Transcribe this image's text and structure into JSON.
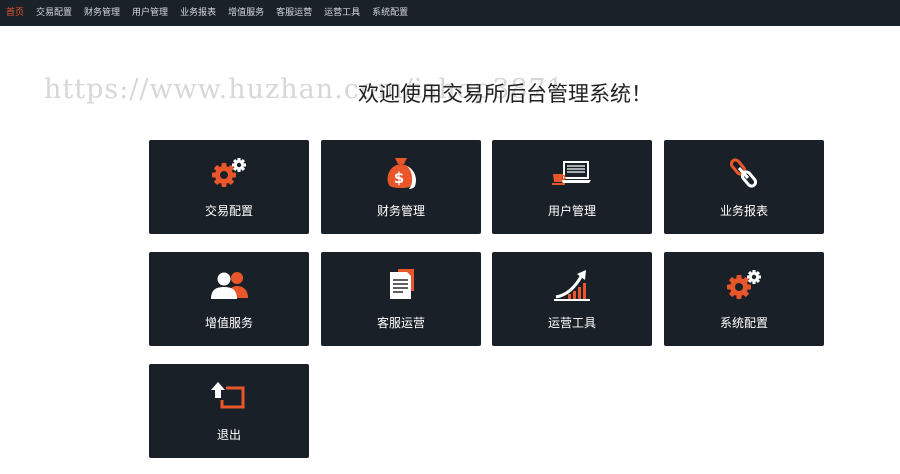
{
  "nav": {
    "items": [
      {
        "label": "首页",
        "active": true
      },
      {
        "label": "交易配置"
      },
      {
        "label": "财务管理"
      },
      {
        "label": "用户管理"
      },
      {
        "label": "业务报表"
      },
      {
        "label": "增值服务"
      },
      {
        "label": "客服运营"
      },
      {
        "label": "运营工具"
      },
      {
        "label": "系统配置"
      }
    ]
  },
  "watermark": "https://www.huzhan.com/ishop3871",
  "welcome": "欢迎使用交易所后台管理系统！",
  "tiles": [
    {
      "label": "交易配置",
      "icon": "gears-icon"
    },
    {
      "label": "财务管理",
      "icon": "money-bag-icon"
    },
    {
      "label": "用户管理",
      "icon": "laptop-coffee-icon"
    },
    {
      "label": "业务报表",
      "icon": "link-icon"
    },
    {
      "label": "增值服务",
      "icon": "users-icon"
    },
    {
      "label": "客服运营",
      "icon": "document-icon"
    },
    {
      "label": "运营工具",
      "icon": "growth-chart-icon"
    },
    {
      "label": "系统配置",
      "icon": "gears-icon"
    },
    {
      "label": "退出",
      "icon": "exit-icon"
    }
  ],
  "colors": {
    "nav_bg": "#1b2129",
    "tile_bg": "#1a2028",
    "accent": "#e8562a",
    "text": "#ffffff"
  }
}
